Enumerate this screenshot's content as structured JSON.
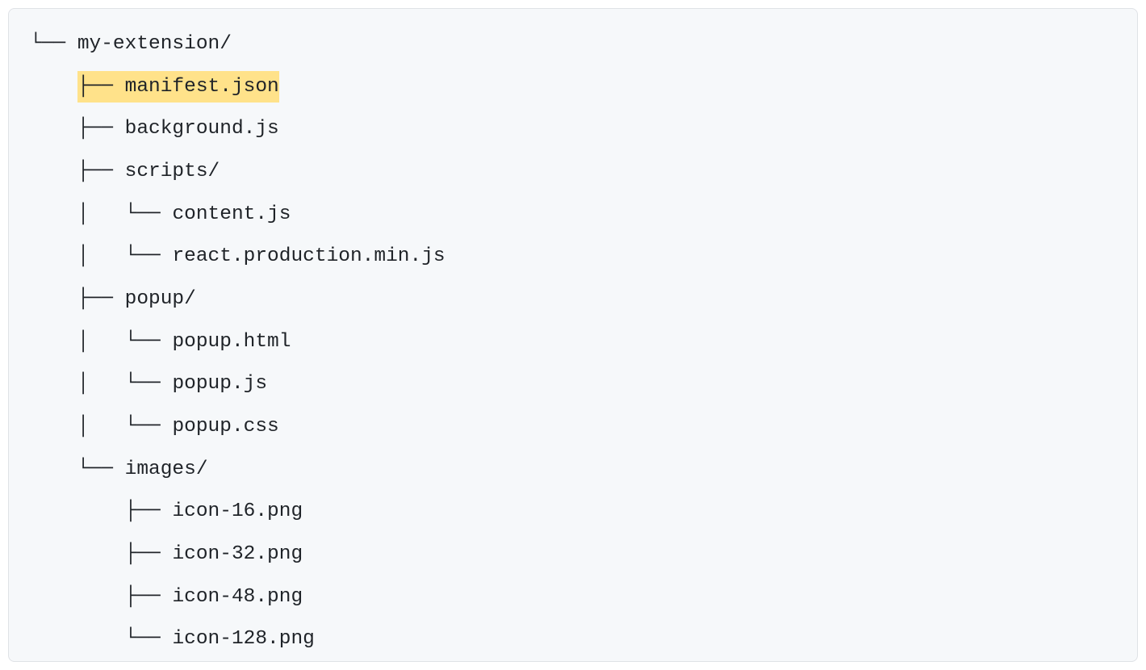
{
  "tree": {
    "lines": [
      {
        "prefix": "└── ",
        "name": "my-extension/",
        "highlighted": false
      },
      {
        "prefix": "    ├── ",
        "name": "manifest.json",
        "highlighted": true
      },
      {
        "prefix": "    ├── ",
        "name": "background.js",
        "highlighted": false
      },
      {
        "prefix": "    ├── ",
        "name": "scripts/",
        "highlighted": false
      },
      {
        "prefix": "    │   └── ",
        "name": "content.js",
        "highlighted": false
      },
      {
        "prefix": "    │   └── ",
        "name": "react.production.min.js",
        "highlighted": false
      },
      {
        "prefix": "    ├── ",
        "name": "popup/",
        "highlighted": false
      },
      {
        "prefix": "    │   └── ",
        "name": "popup.html",
        "highlighted": false
      },
      {
        "prefix": "    │   └── ",
        "name": "popup.js",
        "highlighted": false
      },
      {
        "prefix": "    │   └── ",
        "name": "popup.css",
        "highlighted": false
      },
      {
        "prefix": "    └── ",
        "name": "images/",
        "highlighted": false
      },
      {
        "prefix": "        ├── ",
        "name": "icon-16.png",
        "highlighted": false
      },
      {
        "prefix": "        ├── ",
        "name": "icon-32.png",
        "highlighted": false
      },
      {
        "prefix": "        ├── ",
        "name": "icon-48.png",
        "highlighted": false
      },
      {
        "prefix": "        └── ",
        "name": "icon-128.png",
        "highlighted": false
      }
    ]
  },
  "highlight_color": "#ffe28a"
}
